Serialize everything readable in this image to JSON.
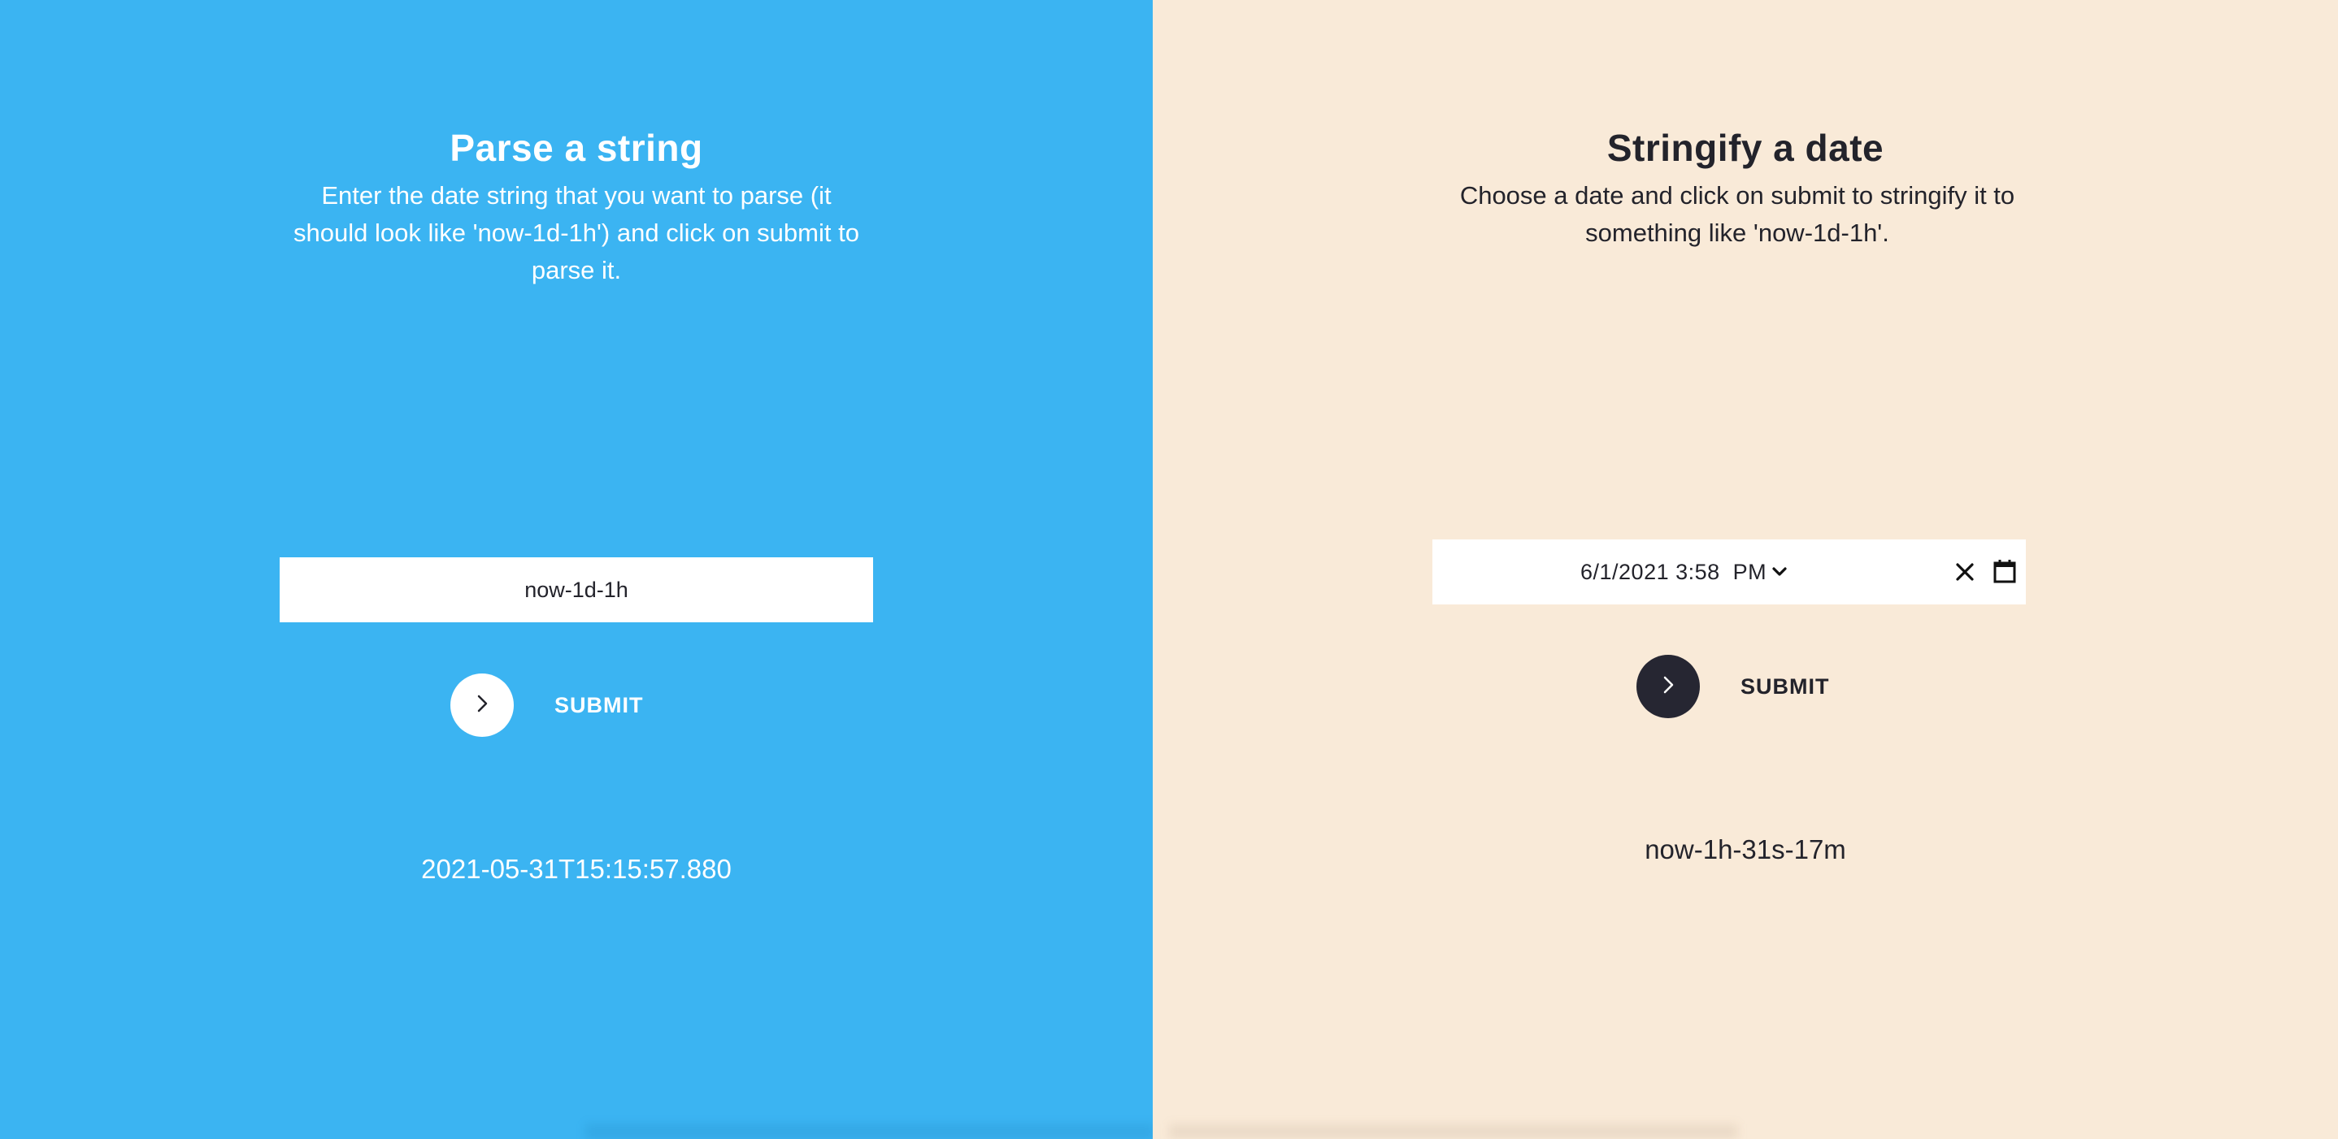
{
  "colors": {
    "left_background": "#3bb4f2",
    "right_background": "#f9ead8",
    "dark_text": "#23232b",
    "dark_button": "#262632",
    "light_button": "#ffffff"
  },
  "parse": {
    "title": "Parse a string",
    "description": "Enter the date string that you want to parse (it should look like 'now-1d-1h') and click on submit to parse it.",
    "input_value": "now-1d-1h",
    "submit_icon": "chevron-right-icon",
    "submit_label": "SUBMIT",
    "result": "2021-05-31T15:15:57.880"
  },
  "stringify": {
    "title": "Stringify a date",
    "description": "Choose a date and click on submit to stringify it to something like 'now-1d-1h'.",
    "datetime_value": "6/1/2021 3:58",
    "datetime_ampm": "PM",
    "clear_icon": "close-icon",
    "calendar_icon": "calendar-icon",
    "submit_icon": "chevron-right-icon",
    "submit_label": "SUBMIT",
    "result": "now-1h-31s-17m"
  }
}
